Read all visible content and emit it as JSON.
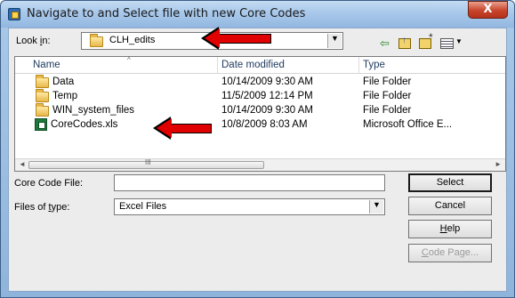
{
  "dialog": {
    "title": "Navigate to and Select file with new Core Codes",
    "close_symbol": "X"
  },
  "look_in": {
    "label": "Look in:",
    "value": "CLH_edits",
    "dropdown_symbol": "▼"
  },
  "toolbar": {
    "back_symbol": "⇦",
    "view_menu_symbol": "▼",
    "icons": [
      "back-icon",
      "up-folder-icon",
      "new-folder-icon",
      "view-menu-icon"
    ]
  },
  "file_list": {
    "columns": [
      "Name",
      "Date modified",
      "Type"
    ],
    "rows": [
      {
        "name": "Data",
        "date": "10/14/2009 9:30 AM",
        "type": "File Folder",
        "icon": "folder-icon"
      },
      {
        "name": "Temp",
        "date": "11/5/2009 12:14 PM",
        "type": "File Folder",
        "icon": "folder-icon"
      },
      {
        "name": "WIN_system_files",
        "date": "10/14/2009 9:30 AM",
        "type": "File Folder",
        "icon": "folder-icon"
      },
      {
        "name": "CoreCodes.xls",
        "date": "10/8/2009 8:03 AM",
        "type": "Microsoft Office E...",
        "icon": "excel-file-icon"
      }
    ],
    "scroll_grip": "III",
    "scroll_left": "◄",
    "scroll_right": "►",
    "sort_caret": "^"
  },
  "form": {
    "core_code_file_label": "Core Code File:",
    "core_code_file_value": "",
    "files_of_type_label": "Files of type:",
    "files_of_type_value": "Excel Files"
  },
  "buttons": {
    "select": "Select",
    "cancel": "Cancel",
    "help": "Help",
    "code_page": "Code Page..."
  },
  "colors": {
    "annotation_arrow": "#e00000",
    "title_bar": "#a8c8ea",
    "close_button": "#c7442a"
  }
}
